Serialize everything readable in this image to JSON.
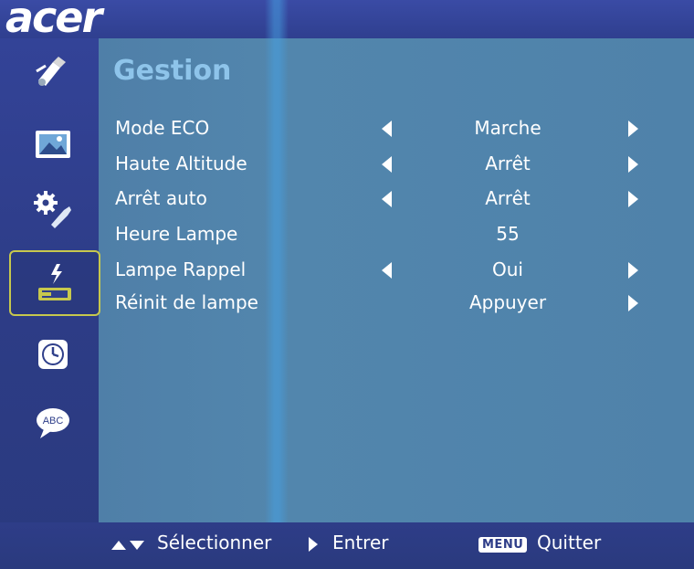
{
  "brand": "acer",
  "page_title": "Gestion",
  "sidebar": {
    "items": [
      {
        "icon": "color-management-icon",
        "active": false
      },
      {
        "icon": "image-icon",
        "active": false
      },
      {
        "icon": "settings-tools-icon",
        "active": false
      },
      {
        "icon": "lamp-management-icon",
        "active": true
      },
      {
        "icon": "clock-icon",
        "active": false
      },
      {
        "icon": "language-abc-icon",
        "active": false,
        "text": "ABC"
      }
    ]
  },
  "settings": [
    {
      "label": "Mode ECO",
      "value": "Marche",
      "left_arrow": true,
      "right_arrow": true
    },
    {
      "label": "Haute Altitude",
      "value": "Arrêt",
      "left_arrow": true,
      "right_arrow": true
    },
    {
      "label": "Arrêt auto",
      "value": "Arrêt",
      "left_arrow": true,
      "right_arrow": true
    },
    {
      "label": "Heure Lampe",
      "value": "55",
      "left_arrow": false,
      "right_arrow": false
    },
    {
      "label": "Lampe Rappel",
      "value": "Oui",
      "left_arrow": true,
      "right_arrow": true
    },
    {
      "label": "Réinit de lampe",
      "value": "Appuyer",
      "left_arrow": false,
      "right_arrow": true
    }
  ],
  "footer": {
    "select_label": "Sélectionner",
    "enter_label": "Entrer",
    "menu_key": "MENU",
    "quit_label": "Quitter"
  },
  "colors": {
    "title": "#8ec4ea",
    "panel": "#5286ad",
    "frame": "#2f3f8a",
    "active_border": "#c7c84d"
  }
}
